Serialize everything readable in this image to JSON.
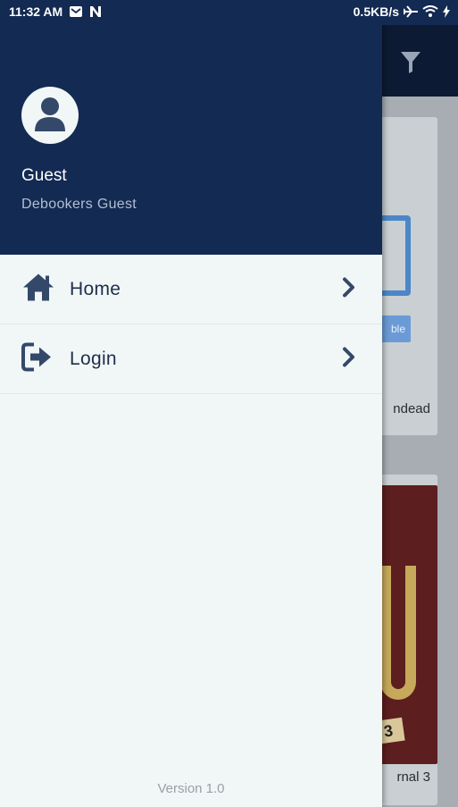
{
  "status_bar": {
    "time": "11:32 AM",
    "net_speed": "0.5KB/s"
  },
  "background": {
    "card1_caption": "ndead",
    "card1_tag": "ble",
    "card2_caption": "rnal 3",
    "card2_badge": "3"
  },
  "drawer": {
    "user_name": "Guest",
    "user_role": "Debookers Guest",
    "menu": [
      {
        "label": "Home",
        "icon": "home-icon"
      },
      {
        "label": "Login",
        "icon": "login-icon"
      }
    ],
    "version": "Version 1.0"
  },
  "colors": {
    "primary": "#132a52",
    "drawer_bg": "#f1f7f7",
    "menu_text": "#1f2f4a",
    "icon": "#34486a"
  }
}
